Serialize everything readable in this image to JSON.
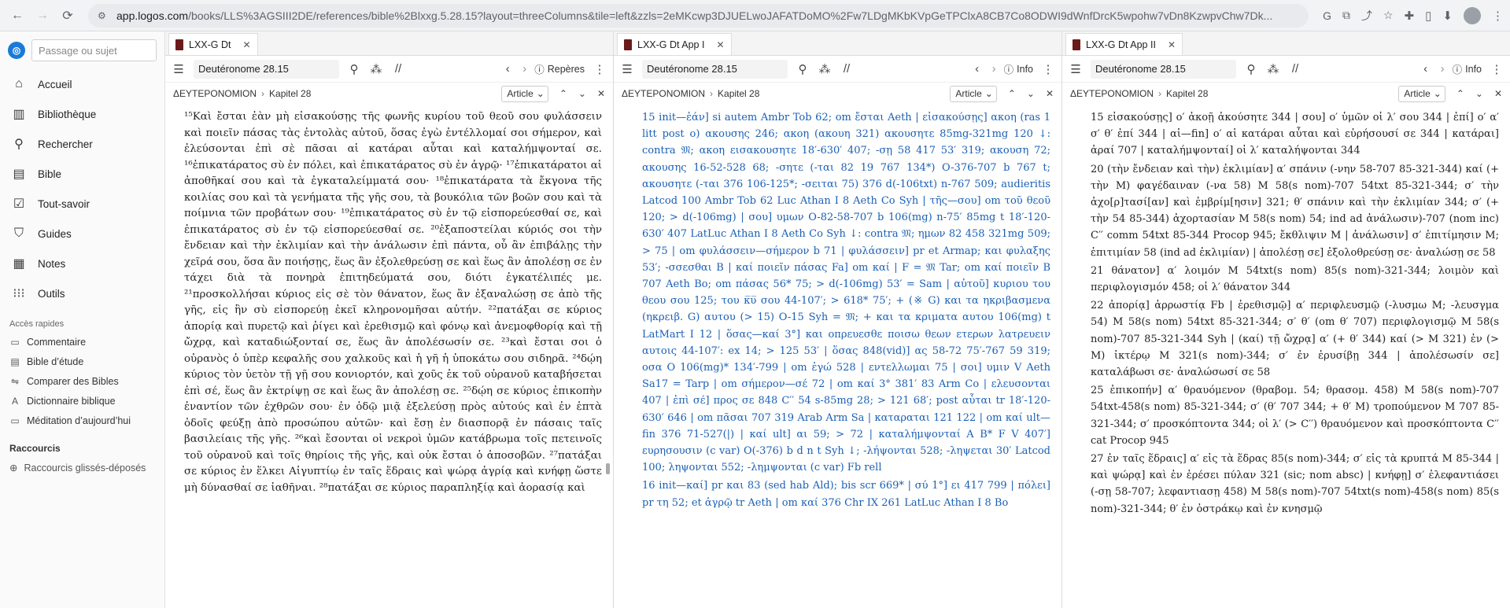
{
  "browser": {
    "url_host": "app.logos.com",
    "url_path": "/books/LLS%3AGSIII2DE/references/bible%2Blxxg.5.28.15?layout=threeColumns&tile=left&zzls=2eMKcwp3DJUELwoJAFATDoMO%2Fw7LDgMKbKVpGeTPClxA8CB7Co8ODWI9dWnfDrcK5wpohw7vDn8KzwpvChw7Dk..."
  },
  "sidebar": {
    "search_placeholder": "Passage ou sujet",
    "nav": [
      {
        "label": "Accueil",
        "icon": "home-icon"
      },
      {
        "label": "Bibliothèque",
        "icon": "library-icon"
      },
      {
        "label": "Rechercher",
        "icon": "search-icon"
      },
      {
        "label": "Bible",
        "icon": "bible-icon"
      },
      {
        "label": "Tout-savoir",
        "icon": "factbook-icon"
      },
      {
        "label": "Guides",
        "icon": "guides-icon"
      },
      {
        "label": "Notes",
        "icon": "notes-icon"
      },
      {
        "label": "Outils",
        "icon": "tools-icon"
      }
    ],
    "quick_title": "Accès rapides",
    "quick": [
      {
        "label": "Commentaire",
        "icon": "commentary-icon"
      },
      {
        "label": "Bible d’étude",
        "icon": "study-bible-icon"
      },
      {
        "label": "Comparer des Bibles",
        "icon": "compare-icon"
      },
      {
        "label": "Dictionnaire biblique",
        "icon": "dictionary-icon"
      },
      {
        "label": "Méditation d’aujourd’hui",
        "icon": "meditation-icon"
      }
    ],
    "shortcuts_title": "Raccourcis",
    "shortcuts_drop": "Raccourcis glissés-déposés"
  },
  "panels": [
    {
      "tab": "LXX-G Dt",
      "reference": "Deutéronome 28.15",
      "right_tool": "Repères",
      "breadcrumb_book": "ΔΕΥΤΕΡΟΝΟΜΙΟΝ",
      "breadcrumb_chapter": "Kapitel 28",
      "view": "Article",
      "paragraphs": [
        "¹⁵Καὶ ἔσται ἐὰν μὴ εἰσακούσῃς τῆς φωνῆς κυρίου τοῦ θεοῦ σου φυλάσσειν καὶ ποιεῖν πάσας τὰς ἐντολὰς αὐτοῦ, ὅσας ἐγὼ ἐντέλλομαί σοι σήμερον, καὶ ἐλεύσονται ἐπὶ σὲ πᾶσαι αἱ κατάραι αὗται καὶ καταλήμψονταί σε. ¹⁶ἐπικατάρατος σὺ ἐν πόλει, καὶ ἐπικατάρατος σὺ ἐν ἀγρῷ· ¹⁷ἐπικατάρατοι αἱ ἀποθῆκαί σου καὶ τὰ ἐγκαταλείμματά σου· ¹⁸ἐπικατάρατα τὰ ἔκγονα τῆς κοιλίας σου καὶ τὰ γενήματα τῆς γῆς σου, τὰ βουκόλια τῶν βοῶν σου καὶ τὰ ποίμνια τῶν προβάτων σου· ¹⁹ἐπικατάρατος σὺ ἐν τῷ εἰσπορεύεσθαί σε, καὶ ἐπικατάρατος σὺ ἐν τῷ εἰσπορεύεσθαί σε. ²⁰ἐξαποστείλαι κύριός σοι τὴν ἔνδειαν καὶ τὴν ἐκλιμίαν καὶ τὴν ἀνάλωσιν ἐπὶ πάντα, οὗ ἂν ἐπιβάλῃς τὴν χεῖρά σου, ὅσα ἂν ποιήσῃς, ἕως ἂν ἐξολεθρεύσῃ σε καὶ ἕως ἂν ἀπολέσῃ σε ἐν τάχει διὰ τὰ πονηρὰ ἐπιτηδεύματά σου, διότι ἐγκατέλιπές με. ²¹προσκολλήσαι κύριος εἰς σὲ τὸν θάνατον, ἕως ἂν ἐξαναλώσῃ σε ἀπὸ τῆς γῆς, εἰς ἣν σὺ εἰσπορεύῃ ἐκεῖ κληρονομῆσαι αὐτήν. ²²πατάξαι σε κύριος ἀπορίᾳ καὶ πυρετῷ καὶ ῥίγει καὶ ἐρεθισμῷ καὶ φόνῳ καὶ ἀνεμοφθορίᾳ καὶ τῇ ὤχρᾳ, καὶ καταδιώξονταί σε, ἕως ἂν ἀπολέσωσίν σε. ²³καὶ ἔσται σοι ὁ οὐρανὸς ὁ ὑπὲρ κεφαλῆς σου χαλκοῦς καὶ ἡ γῆ ἡ ὑποκάτω σου σιδηρᾶ. ²⁴δῴη κύριος τὸν ὑετὸν τῇ γῇ σου κονιορτόν, καὶ χοῦς ἐκ τοῦ οὐρανοῦ καταβήσεται ἐπὶ σέ, ἕως ἂν ἐκτρίψῃ σε καὶ ἕως ἂν ἀπολέσῃ σε. ²⁵δῴη σε κύριος ἐπικοπὴν ἐναντίον τῶν ἐχθρῶν σου· ἐν ὁδῷ μιᾷ ἐξελεύσῃ πρὸς αὐτούς καὶ ἐν ἑπτὰ ὁδοῖς φεύξῃ ἀπὸ προσώπου αὐτῶν· καὶ ἔσῃ ἐν διασπορᾷ ἐν πάσαις ταῖς βασιλείαις τῆς γῆς. ²⁶καὶ ἔσονται οἱ νεκροὶ ὑμῶν κατάβρωμα τοῖς πετεινοῖς τοῦ οὐρανοῦ καὶ τοῖς θηρίοις τῆς γῆς, καὶ οὐκ ἔσται ὁ ἀποσοβῶν. ²⁷πατάξαι σε κύριος ἐν ἕλκει Αἰγυπτίῳ ἐν ταῖς ἕδραις καὶ ψώρᾳ ἀγρίᾳ καὶ κνήφῃ ὥστε μὴ δύνασθαί σε ἰαθῆναι. ²⁸πατάξαι σε κύριος παραπληξίᾳ καὶ ἀορασίᾳ καὶ"
      ]
    },
    {
      "tab": "LXX-G Dt App I",
      "reference": "Deutéronome 28.15",
      "right_tool": "Info",
      "breadcrumb_book": "ΔΕΥΤΕΡΟΝΟΜΙΟΝ",
      "breadcrumb_chapter": "Kapitel 28",
      "view": "Article",
      "paragraphs": [
        "15 init—ἐάν] si autem Ambr Tob 62; om ἔσται Aeth | εἰσακούσῃς] ακοη (ras 1 litt post ο) ακουσης 246; ακοη (ακουη 321) ακουσητε 85mg-321mg 120 ↓: contra 𝔐; ακοη εισακουσητε 18′-630′ 407; -σῃ 58 417 53′ 319; ακουση 72; ακουσης 16-52-528 68; -σητε (-ται 82 19 767 134*) O-376-707 b 767 t; ακουσητε (-ται 376 106-125*; -σειται 75) 376 d(-106txt) n-767 509; audieritis Latcod 100 Ambr Tob 62 Luc Athan I 8 Aeth Co Syh | τῆς—σου] om τοῦ θεοῦ 120; > d(-106mg) | σου] υμων O-82-58-707 b 106(mg) n-75′ 85mg t 18′-120-630′ 407 LatLuc Athan I 8 Aeth Co Syh ↓: contra 𝔐; ημων 82 458 321mg 509; > 75 | om φυλάσσειν—σήμερον b 71 | φυλάσσειν] pr et Armap; και φυλαξης 53′; -σσεσθαι B | καί ποιεῖν πάσας Fa] om καί | F = 𝔐 Tar; om καί ποιεῖν B 707 Aeth Bo; om πάσας 56* 75; > d(-106mg) 53′ = Sam | αὐτοῦ] κυριου του θεου σου 125; του κ̅υ̅ σου 44-107′; > 618* 75′; + (※ G) και τα ηκριβασμενα (ηκρειβ. G) αυτου (> 15) O-15 Syh = 𝔐; + και τα κριματα αυτου 106(mg) t LatMart I 12 | ὅσας—καί 3°] και οπρευεσθε ποισω θεων ετερων λατρευειν αυτοις 44-107′: ex 14; > 125 53′ | ὅσας 848(vid)] ας 58-72 75′-767 59 319; οσα O 106(mg)* 134′-799 | om ἐγώ 528 | εντελλωμαι 75 | σοι] υμιν V Aeth Sa17 = Tarp | om σήμερον—σέ 72 | om καί 3° 381′ 83 Arm Co | ελευσονται 407 | ἐπὶ σέ] προς σε 848 C′′ 54 s-85mg 28; > 121 68′; post αὗται tr 18′-120-630′ 646 | om πᾶσαι 707 319 Arab Arm Sa | καταραται 121 122 | om καί ult—fin 376 71-527(|) | καί ult] αι 59; > 72 | καταλήμψονταί A B* F V 407′] ευρησουσιν (c var) O(-376) b d n t Syh ↓; -λήψονται 528; -ληψεται 30′ Latcod 100; ληψονται 552; -λημψονται (c var) Fb rell",
        "16 init—καί] pr και 83 (sed hab Ald); bis scr 669* | σύ 1°] ει 417 799 | πόλει] pr τη 52; et ἀγρῷ tr Aeth | om καί 376 Chr IX 261 LatLuc Athan I 8 Bo"
      ]
    },
    {
      "tab": "LXX-G Dt App II",
      "reference": "Deutéronome 28.15",
      "right_tool": "Info",
      "breadcrumb_book": "ΔΕΥΤΕΡΟΝΟΜΙΟΝ",
      "breadcrumb_chapter": "Kapitel 28",
      "view": "Article",
      "paragraphs": [
        "15 εἰσακούσῃς] ο′ ἀκοῇ ἀκούσητε 344 | σου] ο′ ὑμῶν οἱ λ′ σου 344 | ἐπί] ο′ α′ σ′ θ′ ἐπί 344 | αἱ—fin] ο′ αἱ κατάραι αὗται καὶ εὑρήσουσί σε 344 | κατάραι] ἀραί 707 | καταλήμψονταί] οἱ λ′ καταλήψονται 344",
        "20 (τὴν ἔνδειαν καὶ τὴν) ἐκλιμίαν] α′ σπάνιν (-νην 58-707 85-321-344) καί (+ τὴν M) φαγέδαιναν (-να 58) M 58(s nom)-707 54txt 85-321-344; σ′ τὴν ἀχο[ρ]τασί[αν] καὶ ἐμβρίμ[ησιν] 321; θ′ σπάνιν καὶ τὴν ἐκλιμίαν 344; σ′ (+ τὴν 54 85-344) ἀχορτασίαν M 58(s nom) 54; ind ad ἀνάλωσιν)-707 (nom inc) C′′ comm 54txt 85-344 Procop 945; ἔκθλιψιν M | ἀνάλωσιν] σ′ ἐπιτίμησιν M; ἐπιτιμίαν 58 (ind ad ἐκλιμίαν) | ἀπολέσῃ σε] ἐξολοθρεύσῃ σε· ἀναλώσῃ σε 58",
        "21 θάνατον] α′ λοιμόν M 54txt(s nom) 85(s nom)-321-344; λοιμὸν καὶ περιφλογισμόν 458; οἱ λ′ θάνατον 344",
        "22 ἀπορίᾳ] ἀρρωστίᾳ Fb | ἐρεθισμῷ] α′ περιφλευσμῷ (-λυσμω M; -λευσγμα 54) M 58(s nom) 54txt 85-321-344; σ′ θ′ (om θ′ 707) περιφλογισμῷ M 58(s nom)-707 85-321-344 Syh | (καί) τῇ ὤχρᾳ] α′ (+ θ′ 344) καί (> M 321) ἐν (> M) ἰκτέρῳ M 321(s nom)-344; σ′ ἐν ἐρυσίβῃ 344 | ἀπολέσωσίν σε] καταλάβωσι σε· ἀναλώσωσί σε 58",
        "25 ἐπικοπήν] α′ θραυόμενον (θραβομ. 54; θρασομ. 458) M 58(s nom)-707 54txt-458(s nom) 85-321-344; σ′ (θ′ 707 344; + θ′ M) τροπούμενον M 707 85-321-344; σ′ προσκόπτοντα 344; οἱ λ′ (> C′′) θραυόμενον καὶ προσκόπτοντα C′′ cat Procop 945",
        "27 ἐν ταῖς ἕδραις] α′ εἰς τὰ ἕδρας 85(s nom)-344; σ′ εἰς τὰ κρυπτά M 85-344 | καὶ ψώρᾳ] καὶ ἐν ἐρέσει πύλαν 321 (sic; nom absc) | κνήφῃ] σ′ ἐλεφαντιάσει (-σῃ 58-707; λεφαντιασῃ 458) M 58(s nom)-707 54txt(s nom)-458(s nom) 85(s nom)-321-344; θ′ ἐν ὀστράκῳ καὶ ἐν κνησμῷ"
      ]
    }
  ]
}
